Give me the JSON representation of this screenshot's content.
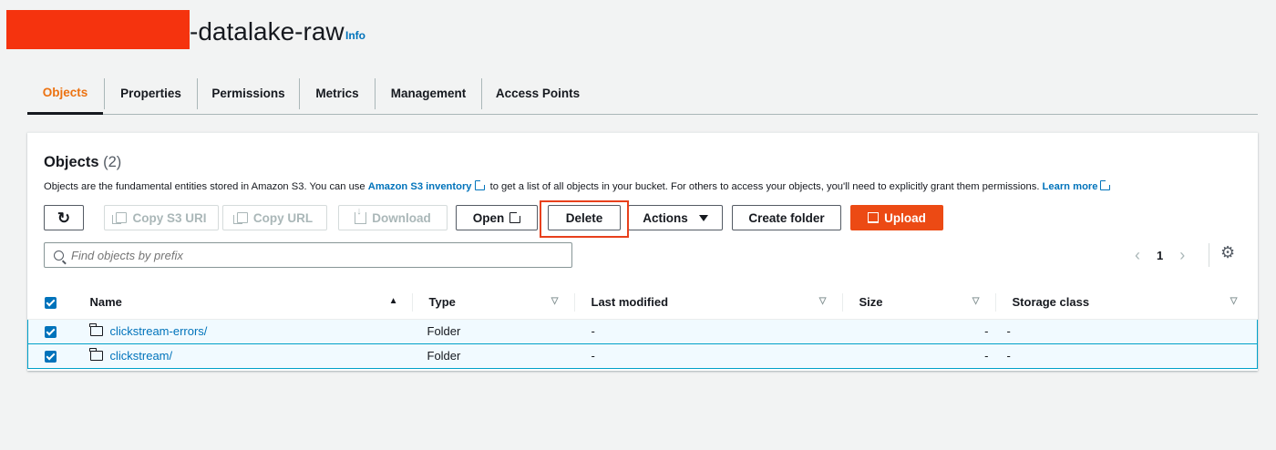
{
  "header": {
    "bucket_name": "-datalake-raw",
    "info_label": "Info"
  },
  "tabs": [
    {
      "label": "Objects",
      "active": true
    },
    {
      "label": "Properties"
    },
    {
      "label": "Permissions"
    },
    {
      "label": "Metrics"
    },
    {
      "label": "Management"
    },
    {
      "label": "Access Points"
    }
  ],
  "panel": {
    "title": "Objects",
    "count": "(2)",
    "description_1": "Objects are the fundamental entities stored in Amazon S3. You can use ",
    "inventory_link": "Amazon S3 inventory",
    "description_2": " to get a list of all objects in your bucket. For others to access your objects, you'll need to explicitly grant them permissions. ",
    "learn_more": "Learn more"
  },
  "toolbar": {
    "refresh_icon": "refresh-icon",
    "copy_s3_uri": "Copy S3 URI",
    "copy_url": "Copy URL",
    "download": "Download",
    "open": "Open",
    "delete": "Delete",
    "actions": "Actions",
    "create_folder": "Create folder",
    "upload": "Upload"
  },
  "search": {
    "placeholder": "Find objects by prefix"
  },
  "pagination": {
    "page": "1"
  },
  "table": {
    "columns": [
      "Name",
      "Type",
      "Last modified",
      "Size",
      "Storage class"
    ],
    "rows": [
      {
        "name": "clickstream-errors/",
        "type": "Folder",
        "last_modified": "-",
        "size": "-",
        "storage_class": "-"
      },
      {
        "name": "clickstream/",
        "type": "Folder",
        "last_modified": "-",
        "size": "-",
        "storage_class": "-"
      }
    ]
  },
  "colors": {
    "accent": "#ec7211",
    "primary_button": "#ec4a14",
    "link": "#0073bb",
    "highlight": "#e8401c",
    "redaction": "#f5330e"
  }
}
